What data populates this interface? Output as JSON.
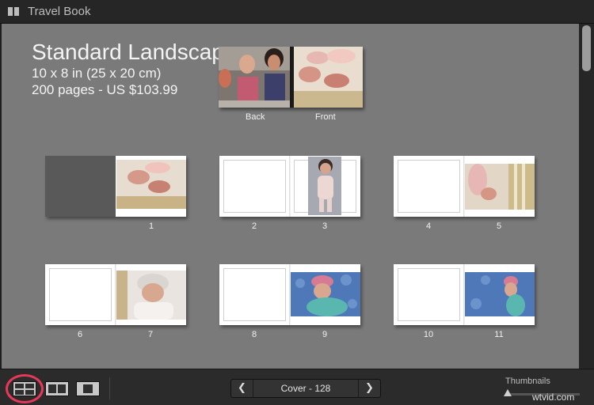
{
  "window": {
    "title": "Travel Book"
  },
  "book": {
    "title": "Standard Landscape",
    "size": "10 x 8 in (25 x 20 cm)",
    "pages_price": "200 pages - US $103.99"
  },
  "cover": {
    "back_label": "Back",
    "front_label": "Front"
  },
  "spreads": [
    {
      "left_page": "",
      "right_page": "1"
    },
    {
      "left_page": "2",
      "right_page": "3"
    },
    {
      "left_page": "4",
      "right_page": "5"
    },
    {
      "left_page": "6",
      "right_page": "7"
    },
    {
      "left_page": "8",
      "right_page": "9"
    },
    {
      "left_page": "10",
      "right_page": "11"
    }
  ],
  "toolbar": {
    "views": [
      "multi-page-view-button",
      "spread-view-button",
      "single-page-view-button"
    ],
    "nav_label": "Cover - 128",
    "prev_icon": "chevron-left-icon",
    "next_icon": "chevron-right-icon",
    "thumbnails_label": "Thumbnails",
    "watermark": "wtvid.com"
  },
  "colors": {
    "background": "#7a7a7a",
    "highlight_circle": "#e8385a"
  }
}
